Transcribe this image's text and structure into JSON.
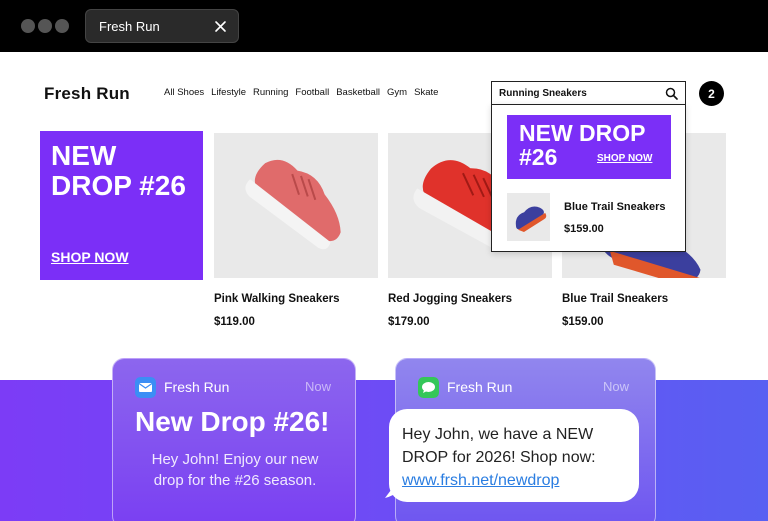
{
  "browser": {
    "tab_title": "Fresh Run"
  },
  "header": {
    "brand": "Fresh Run",
    "nav": [
      "All Shoes",
      "Lifestyle",
      "Running",
      "Football",
      "Basketball",
      "Gym",
      "Skate"
    ],
    "search_value": "Running Sneakers",
    "cart_count": "2"
  },
  "promo": {
    "headline": "NEW DROP #26",
    "cta": "SHOP NOW"
  },
  "products": [
    {
      "name": "Pink Walking Sneakers",
      "price": "$119.00",
      "color": "#e06b6b"
    },
    {
      "name": "Red Jogging Sneakers",
      "price": "$179.00",
      "color": "#e0322b"
    },
    {
      "name": "Blue Trail Sneakers",
      "price": "$159.00",
      "color": "#3b3f9e"
    }
  ],
  "search_dropdown": {
    "promo_headline": "NEW DROP #26",
    "promo_cta": "SHOP NOW",
    "result_name": "Blue Trail Sneakers",
    "result_price": "$159.00"
  },
  "email_notification": {
    "app": "Fresh Run",
    "time": "Now",
    "title": "New Drop #26!",
    "body": "Hey John! Enjoy our new drop for the #26 season."
  },
  "sms_notification": {
    "app": "Fresh Run",
    "time": "Now",
    "message": "Hey John, we have a NEW DROP for 2026! Shop now:",
    "link": "www.frsh.net/newdrop"
  },
  "colors": {
    "brand_purple": "#7b2ff7",
    "link_blue": "#2a7de1",
    "mail_icon": "#3b8ef5",
    "sms_icon": "#34c759"
  }
}
